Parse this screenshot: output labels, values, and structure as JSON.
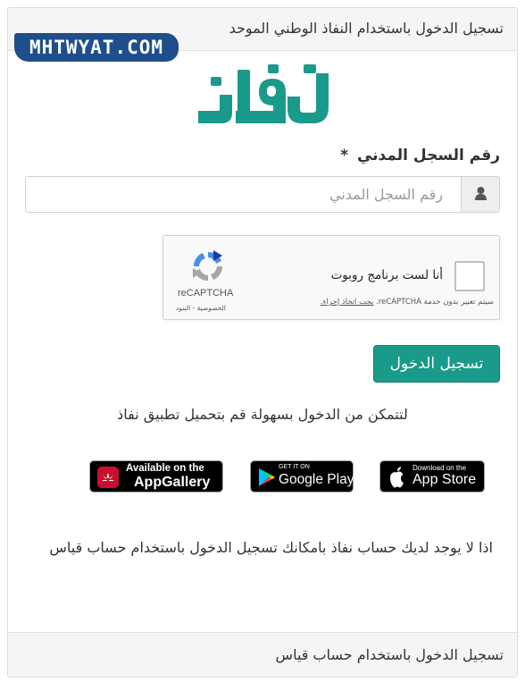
{
  "header": {
    "title": "تسجيل الدخول باستخدام النفاذ الوطني الموحد"
  },
  "watermark": {
    "text": "MHTWYAT.COM"
  },
  "logo": {
    "text": "نفاذ",
    "color": "#1a9a8a"
  },
  "form": {
    "field_label": "رقم السجل المدني",
    "required_mark": "*",
    "placeholder": "رقم السجل المدني",
    "value": ""
  },
  "captcha": {
    "checkbox_label": "أنا لست برنامج روبوت",
    "brand": "reCAPTCHA",
    "terms_prefix": "سيتم تعبير بدون خدمة reCAPTCHA.",
    "terms_link": "يجب اتخاذ إجراء.",
    "links": "الخصوصية - البنود"
  },
  "login_button": {
    "label": "تسجيل الدخول"
  },
  "download": {
    "text": "لتتمكن من الدخول بسهولة قم بتحميل تطبيق نفاذ"
  },
  "stores": {
    "huawei": {
      "small": "Available on the",
      "big": "AppGallery",
      "icon": "huawei-icon"
    },
    "google": {
      "small": "GET IT ON",
      "big": "Google Play",
      "icon": "google-play-icon"
    },
    "apple": {
      "small": "Download on the",
      "big": "App Store",
      "icon": "apple-icon"
    }
  },
  "no_account": {
    "text": "اذا لا يوجد لديك حساب نفاذ بامكانك تسجيل الدخول باستخدام حساب قياس"
  },
  "footer": {
    "title": "تسجيل الدخول باستخدام حساب قياس"
  },
  "colors": {
    "accent": "#1a9a8a",
    "watermark_bg": "#1f4e8c"
  }
}
